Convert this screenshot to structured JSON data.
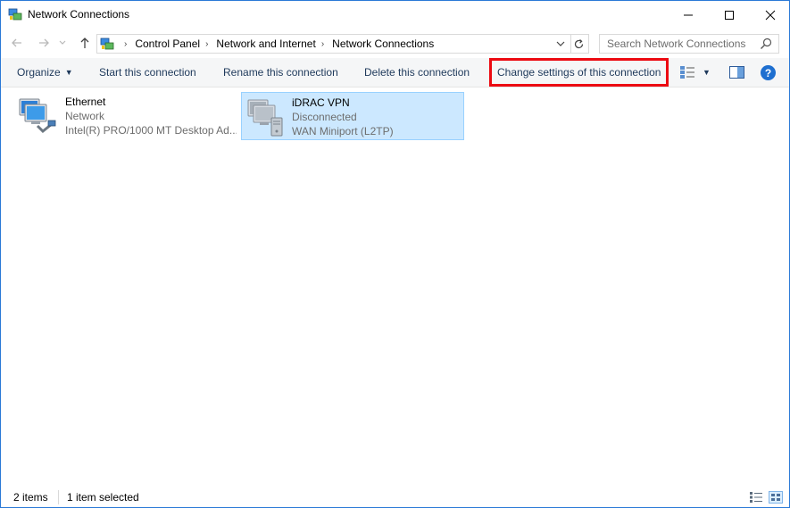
{
  "window": {
    "title": "Network Connections"
  },
  "address": {
    "crumbs": [
      "Control Panel",
      "Network and Internet",
      "Network Connections"
    ]
  },
  "search": {
    "placeholder": "Search Network Connections"
  },
  "toolbar": {
    "organize_label": "Organize",
    "start_label": "Start this connection",
    "rename_label": "Rename this connection",
    "delete_label": "Delete this connection",
    "change_label": "Change settings of this connection",
    "help_label": "?"
  },
  "connections": [
    {
      "name": "Ethernet",
      "status": "Network",
      "device": "Intel(R) PRO/1000 MT Desktop Ad...",
      "selected": false
    },
    {
      "name": "iDRAC VPN",
      "status": "Disconnected",
      "device": "WAN Miniport (L2TP)",
      "selected": true
    }
  ],
  "status": {
    "item_count": "2 items",
    "selected_count": "1 item selected"
  },
  "colors": {
    "accent": "#2b79d7",
    "highlight": "#ec0a12",
    "selection": "#cce8ff",
    "command_text": "#1e395b"
  }
}
